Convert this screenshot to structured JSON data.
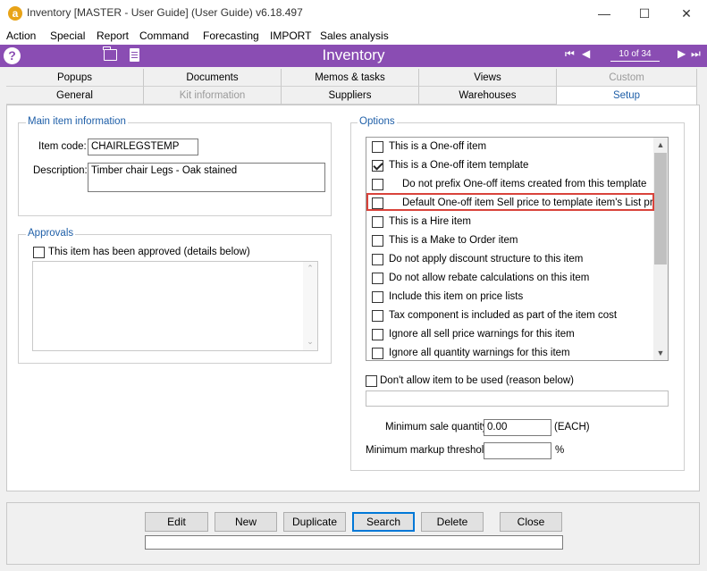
{
  "window": {
    "title": "Inventory [MASTER - User Guide] (User Guide) v6.18.497",
    "logo": "a"
  },
  "menu": [
    "Action",
    "Special",
    "Report",
    "Command",
    "Forecasting",
    "IMPORT",
    "Sales analysis"
  ],
  "toolbar": {
    "title": "Inventory",
    "record_counter": "10 of 34",
    "icons": [
      "help-icon",
      "folder-icon",
      "document-icon",
      "first-record-icon",
      "previous-record-icon",
      "next-record-icon",
      "last-record-icon"
    ]
  },
  "tabs_row1": [
    {
      "label": "Popups",
      "state": "normal"
    },
    {
      "label": "Documents",
      "state": "normal"
    },
    {
      "label": "Memos & tasks",
      "state": "normal"
    },
    {
      "label": "Views",
      "state": "normal"
    },
    {
      "label": "Custom",
      "state": "disabled"
    }
  ],
  "tabs_row2": [
    {
      "label": "General",
      "state": "normal"
    },
    {
      "label": "Kit information",
      "state": "disabled"
    },
    {
      "label": "Suppliers",
      "state": "normal"
    },
    {
      "label": "Warehouses",
      "state": "normal"
    },
    {
      "label": "Setup",
      "state": "active"
    }
  ],
  "main_info": {
    "group_title": "Main item information",
    "item_code_label": "Item code:",
    "item_code_value": "CHAIRLEGSTEMP",
    "description_label": "Description:",
    "description_value": "Timber chair Legs - Oak stained"
  },
  "approvals": {
    "group_title": "Approvals",
    "approved_label": "This item has been approved (details below)",
    "approved_checked": false
  },
  "options": {
    "group_title": "Options",
    "items": [
      {
        "label": "This is a One-off item",
        "checked": false,
        "indent": false,
        "highlighted": false
      },
      {
        "label": "This is a One-off item template",
        "checked": true,
        "indent": false,
        "highlighted": false
      },
      {
        "label": "Do not prefix One-off items created from this template",
        "checked": false,
        "indent": true,
        "highlighted": false
      },
      {
        "label": "Default One-off item Sell price to template item's List price",
        "checked": false,
        "indent": true,
        "highlighted": true
      },
      {
        "label": "This is a Hire item",
        "checked": false,
        "indent": false,
        "highlighted": false
      },
      {
        "label": "This is a Make to Order item",
        "checked": false,
        "indent": false,
        "highlighted": false
      },
      {
        "label": "Do not apply discount structure to this item",
        "checked": false,
        "indent": false,
        "highlighted": false
      },
      {
        "label": "Do not allow rebate calculations on this item",
        "checked": false,
        "indent": false,
        "highlighted": false
      },
      {
        "label": "Include this item on price lists",
        "checked": false,
        "indent": false,
        "highlighted": false
      },
      {
        "label": "Tax component is included as part of the item cost",
        "checked": false,
        "indent": false,
        "highlighted": false
      },
      {
        "label": "Ignore all sell price warnings for this item",
        "checked": false,
        "indent": false,
        "highlighted": false
      },
      {
        "label": "Ignore all quantity warnings for this item",
        "checked": false,
        "indent": false,
        "highlighted": false
      }
    ],
    "dont_allow_label": "Don't allow item to be used (reason below)",
    "dont_allow_checked": false,
    "min_sale_qty_label": "Minimum sale quantity:",
    "min_sale_qty_value": "0.00",
    "min_sale_qty_unit": "(EACH)",
    "min_markup_label": "Minimum markup threshold:",
    "min_markup_value": "",
    "min_markup_unit": "%"
  },
  "buttons": [
    "Edit",
    "New",
    "Duplicate",
    "Search",
    "Delete",
    "Close"
  ],
  "colors": {
    "toolbar": "#8a4db3",
    "accent_text": "#1f5fa8",
    "highlight_border": "#d9433b"
  }
}
